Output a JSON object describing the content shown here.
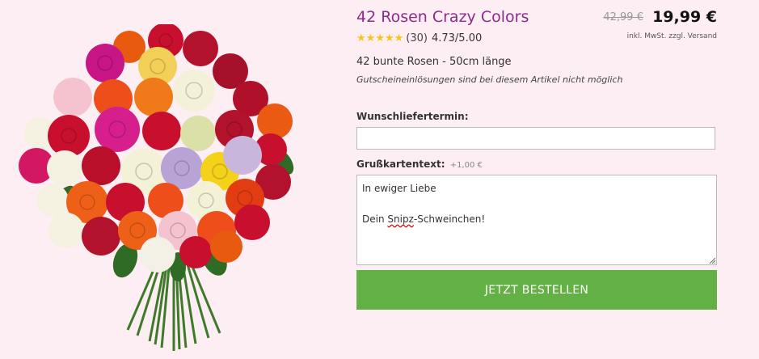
{
  "product": {
    "title": "42 Rosen Crazy Colors",
    "old_price": "42,99 €",
    "new_price": "19,99 €",
    "shipping_note": "inkl. MwSt. zzgl. Versand",
    "rating": {
      "stars": 5,
      "count": "(30)",
      "score": "4.73",
      "max": "/5.00"
    },
    "description": "42 bunte Rosen - 50cm länge",
    "voucher_note": "Gutscheineinlösungen sind bei diesem Artikel nicht möglich"
  },
  "form": {
    "date_label": "Wunschliefertermin:",
    "date_value": "",
    "card_label": "Grußkartentext:",
    "card_surcharge": "+1,00 €",
    "card_line1": "In ewiger Liebe",
    "card_line3_pre": "Dein ",
    "card_line3_word": "Snipz",
    "card_line3_post": "-Schweinchen!",
    "order_button": "JETZT BESTELLEN"
  },
  "colors": {
    "background": "#fdeef3",
    "title": "#8e2a8d",
    "button": "#63b144",
    "star": "#f5c518"
  },
  "icons": {
    "star": "star-icon",
    "image": "rose-bouquet-image"
  }
}
